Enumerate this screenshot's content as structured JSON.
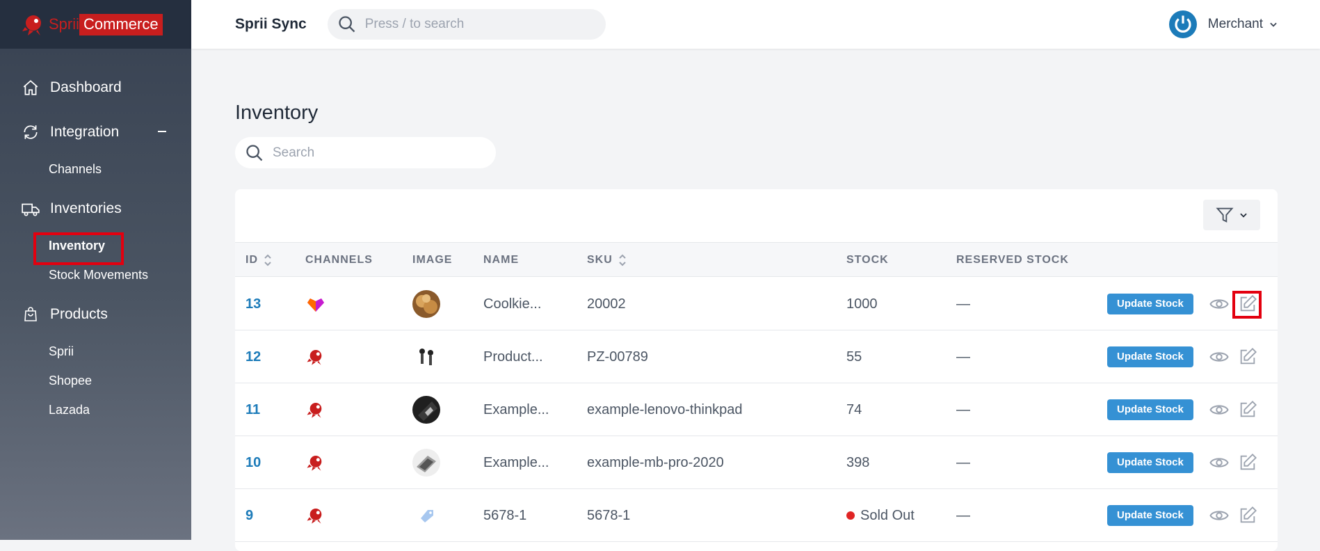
{
  "brand": {
    "part1": "Sprii",
    "part2": "Commerce"
  },
  "topbar": {
    "app_name": "Sprii Sync",
    "search_placeholder": "Press / to search",
    "user_name": "Merchant"
  },
  "sidebar": {
    "dashboard": "Dashboard",
    "integration": "Integration",
    "channels": "Channels",
    "inventories": "Inventories",
    "inventory": "Inventory",
    "stock_movements": "Stock Movements",
    "products": "Products",
    "sprii": "Sprii",
    "shopee": "Shopee",
    "lazada": "Lazada"
  },
  "page": {
    "title": "Inventory",
    "search_placeholder": "Search"
  },
  "table": {
    "headers": {
      "id": "ID",
      "channels": "CHANNELS",
      "image": "IMAGE",
      "name": "NAME",
      "sku": "SKU",
      "stock": "STOCK",
      "reserved": "RESERVED STOCK"
    },
    "rows": [
      {
        "id": "13",
        "channel": "lazada-icon",
        "image": "cookie-image",
        "name": "Coolkie...",
        "sku": "20002",
        "stock": "1000",
        "sold_out": false,
        "reserved": "—",
        "action": "Update Stock"
      },
      {
        "id": "12",
        "channel": "sprii-icon",
        "image": "earbuds-image",
        "name": "Product...",
        "sku": "PZ-00789",
        "stock": "55",
        "sold_out": false,
        "reserved": "—",
        "action": "Update Stock"
      },
      {
        "id": "11",
        "channel": "sprii-icon",
        "image": "thinkpad-image",
        "name": "Example...",
        "sku": "example-lenovo-thinkpad",
        "stock": "74",
        "sold_out": false,
        "reserved": "—",
        "action": "Update Stock"
      },
      {
        "id": "10",
        "channel": "sprii-icon",
        "image": "macbook-image",
        "name": "Example...",
        "sku": "example-mb-pro-2020",
        "stock": "398",
        "sold_out": false,
        "reserved": "—",
        "action": "Update Stock"
      },
      {
        "id": "9",
        "channel": "sprii-icon",
        "image": "tag-image",
        "name": "5678-1",
        "sku": "5678-1",
        "stock": "Sold Out",
        "sold_out": true,
        "reserved": "—",
        "action": "Update Stock"
      }
    ]
  },
  "colors": {
    "accent": "#3591d4",
    "brand_red": "#c81e1e",
    "highlight": "#e3000f",
    "sold_out": "#e02424"
  }
}
